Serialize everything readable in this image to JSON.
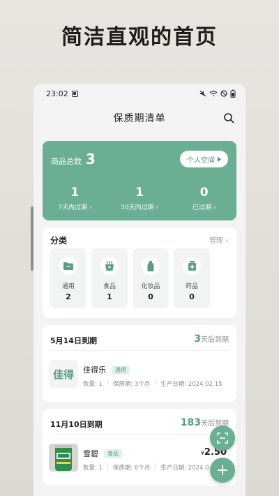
{
  "headline": "简洁直观的首页",
  "status_bar": {
    "time": "23:02",
    "icons": [
      "notification-icon",
      "mute-icon",
      "wifi-icon",
      "no-sim-icon",
      "battery-icon"
    ]
  },
  "nav": {
    "title": "保质期清单"
  },
  "summary": {
    "label": "商品总数",
    "count": "3",
    "space_button": "个人空间",
    "stats": [
      {
        "value": "1",
        "label": "7天内过期 ›"
      },
      {
        "value": "1",
        "label": "30天内过期 ›"
      },
      {
        "value": "0",
        "label": "已过期 ›"
      }
    ]
  },
  "category": {
    "title": "分类",
    "manage": "管理 ›",
    "items": [
      {
        "name": "通用",
        "count": "2",
        "icon": "folder-icon"
      },
      {
        "name": "食品",
        "count": "1",
        "icon": "food-icon"
      },
      {
        "name": "化妆品",
        "count": "0",
        "icon": "cosmetics-icon"
      },
      {
        "name": "药品",
        "count": "0",
        "icon": "medicine-icon"
      }
    ]
  },
  "groups": [
    {
      "date": "5月14日到期",
      "remain_num": "3",
      "remain_text": "天后到期",
      "product": {
        "logo_text": "佳得",
        "name": "佳得乐",
        "tag": "通用",
        "qty": "数量: 1",
        "shelf": "保质期: 3个月",
        "prod_date": "生产日期: 2024.02.15"
      }
    },
    {
      "date": "11月10日到期",
      "remain_num": "183",
      "remain_text": "天后到期",
      "product": {
        "name": "雪碧",
        "tag": "食品",
        "price_symbol": "¥",
        "price": "2.50",
        "qty": "数量: 1",
        "shelf": "保质期: 6个月",
        "prod_date": "生产日期: 2024.0"
      }
    }
  ],
  "colors": {
    "accent": "#6aae94",
    "accent_dark": "#5a9d84",
    "card": "#ffffff",
    "page": "#f3f3f3"
  }
}
